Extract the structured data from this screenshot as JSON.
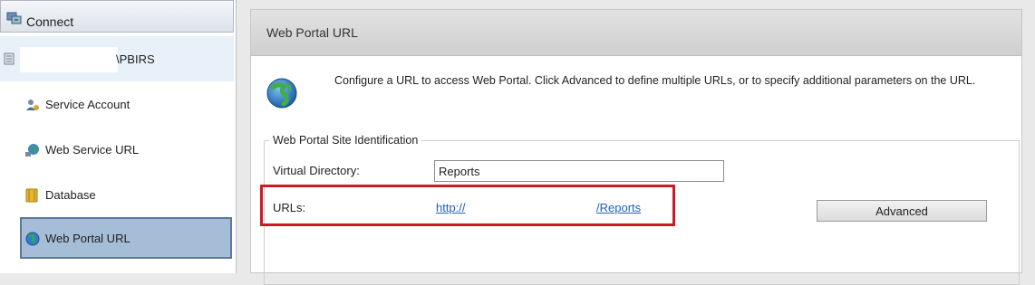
{
  "sidebar": {
    "connect_label": "Connect",
    "server_label": "\\PBIRS",
    "items": [
      {
        "label": "Service Account",
        "icon": "service-account-icon"
      },
      {
        "label": "Web Service URL",
        "icon": "web-service-url-icon"
      },
      {
        "label": "Database",
        "icon": "database-icon"
      },
      {
        "label": "Web Portal URL",
        "icon": "globe-icon",
        "selected": true
      }
    ]
  },
  "main": {
    "title": "Web Portal URL",
    "description": "Configure a URL to access Web Portal.  Click Advanced to define multiple URLs, or to specify additional parameters on the URL.",
    "group": {
      "legend": "Web Portal Site Identification",
      "virtual_directory_label": "Virtual Directory:",
      "virtual_directory_value": "Reports",
      "urls_label": "URLs:",
      "url_part1": "http://",
      "url_part2": "/Reports",
      "advanced_label": "Advanced"
    }
  },
  "colors": {
    "selection": "#a6bdd8",
    "link": "#1f5fbf",
    "highlight": "#cc1b24"
  }
}
